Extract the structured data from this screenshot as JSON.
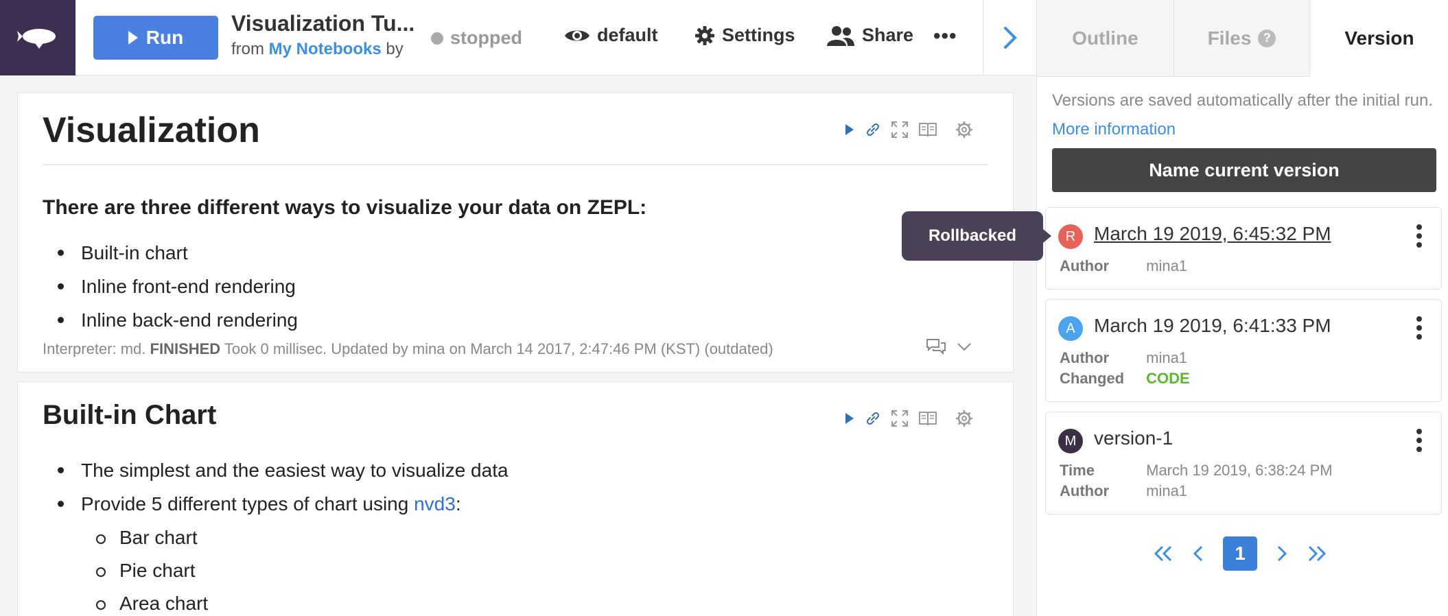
{
  "topbar": {
    "run_label": "Run",
    "notebook_title": "Visualization Tu...",
    "from_prefix": "from",
    "folder_link": "My Notebooks",
    "by_label": "by",
    "status": "stopped",
    "view_mode": "default",
    "settings_label": "Settings",
    "share_label": "Share"
  },
  "paragraphs": [
    {
      "title": "Visualization",
      "heading": "There are three different ways to visualize your data on ZEPL:",
      "bullets": [
        "Built-in chart",
        "Inline front-end rendering",
        "Inline back-end rendering"
      ],
      "footer": {
        "interpreter": "Interpreter: md.",
        "status": "FINISHED",
        "details": "Took 0 millisec. Updated by mina on March 14 2017, 2:47:46 PM (KST) (outdated)"
      }
    },
    {
      "title": "Built-in Chart",
      "bullet1": "The simplest and the easiest way to visualize data",
      "bullet2_prefix": "Provide 5 different types of chart using ",
      "bullet2_link": "nvd3",
      "bullet2_suffix": ":",
      "sub_bullets": [
        "Bar chart",
        "Pie chart",
        "Area chart"
      ]
    }
  ],
  "right_panel": {
    "tabs": [
      "Outline",
      "Files",
      "Version"
    ],
    "active_tab": "Version",
    "files_help": "?",
    "info_text": "Versions are saved automatically after the initial run.",
    "info_link": "More information",
    "name_button": "Name current version",
    "versions": [
      {
        "avatar": "R",
        "avatar_color": "#e8625a",
        "title": "March 19 2019, 6:45:32 PM",
        "author_label": "Author",
        "author": "mina1"
      },
      {
        "avatar": "A",
        "avatar_color": "#4aa3ef",
        "title": "March 19 2019, 6:41:33 PM",
        "author_label": "Author",
        "author": "mina1",
        "changed_label": "Changed",
        "changed": "CODE"
      },
      {
        "avatar": "M",
        "avatar_color": "#3a2f45",
        "title": "version-1",
        "time_label": "Time",
        "time": "March 19 2019, 6:38:24 PM",
        "author_label": "Author",
        "author": "mina1"
      }
    ],
    "pagination": {
      "current": "1"
    }
  },
  "tooltip": "Rollbacked",
  "colors": {
    "accent": "#4a80e0",
    "logo_bg": "#3c2f52",
    "link": "#3a8ee6",
    "changed_code": "#5cb82c"
  }
}
